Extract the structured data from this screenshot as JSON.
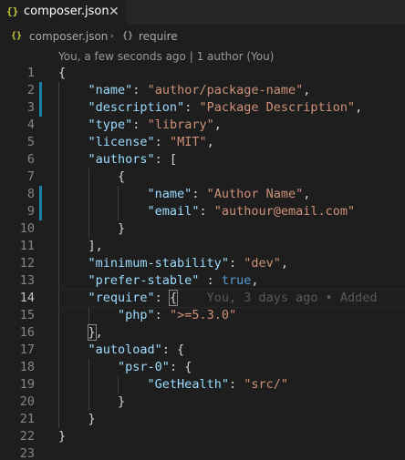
{
  "tab": {
    "icon_glyph": "{}",
    "icon_name": "json-file-icon",
    "label": "composer.json",
    "close_glyph": "✕"
  },
  "breadcrumb": {
    "file_icon_glyph": "{}",
    "file": "composer.json",
    "separator": "›",
    "symbol_icon_glyph": "{}",
    "symbol": "require"
  },
  "codelens": {
    "text": "You, a few seconds ago | 1 author (You)"
  },
  "editor": {
    "active_line": 14,
    "modified_lines": [
      2,
      3,
      8,
      9
    ],
    "colors": {
      "key": "#9cdcfe",
      "string": "#ce9178",
      "boolean": "#569cd6",
      "punctuation": "#d4d4d4",
      "gutter_modified": "#1b81a8"
    },
    "lines": [
      {
        "n": "1",
        "tokens": [
          [
            "p",
            "{"
          ]
        ]
      },
      {
        "n": "2",
        "tokens": [
          [
            "p",
            "    "
          ],
          [
            "k",
            "\"name\""
          ],
          [
            "p",
            ": "
          ],
          [
            "s",
            "\"author/package-name\""
          ],
          [
            "p",
            ","
          ]
        ]
      },
      {
        "n": "3",
        "tokens": [
          [
            "p",
            "    "
          ],
          [
            "k",
            "\"description\""
          ],
          [
            "p",
            ": "
          ],
          [
            "s",
            "\"Package Description\""
          ],
          [
            "p",
            ","
          ]
        ]
      },
      {
        "n": "4",
        "tokens": [
          [
            "p",
            "    "
          ],
          [
            "k",
            "\"type\""
          ],
          [
            "p",
            ": "
          ],
          [
            "s",
            "\"library\""
          ],
          [
            "p",
            ","
          ]
        ]
      },
      {
        "n": "5",
        "tokens": [
          [
            "p",
            "    "
          ],
          [
            "k",
            "\"license\""
          ],
          [
            "p",
            ": "
          ],
          [
            "s",
            "\"MIT\""
          ],
          [
            "p",
            ","
          ]
        ]
      },
      {
        "n": "6",
        "tokens": [
          [
            "p",
            "    "
          ],
          [
            "k",
            "\"authors\""
          ],
          [
            "p",
            ": ["
          ]
        ]
      },
      {
        "n": "7",
        "tokens": [
          [
            "p",
            "        {"
          ]
        ]
      },
      {
        "n": "8",
        "tokens": [
          [
            "p",
            "            "
          ],
          [
            "k",
            "\"name\""
          ],
          [
            "p",
            ": "
          ],
          [
            "s",
            "\"Author Name\""
          ],
          [
            "p",
            ","
          ]
        ]
      },
      {
        "n": "9",
        "tokens": [
          [
            "p",
            "            "
          ],
          [
            "k",
            "\"email\""
          ],
          [
            "p",
            ": "
          ],
          [
            "s",
            "\"authour@email.com\""
          ]
        ]
      },
      {
        "n": "10",
        "tokens": [
          [
            "p",
            "        }"
          ]
        ]
      },
      {
        "n": "11",
        "tokens": [
          [
            "p",
            "    ],"
          ]
        ]
      },
      {
        "n": "12",
        "tokens": [
          [
            "p",
            "    "
          ],
          [
            "k",
            "\"minimum-stability\""
          ],
          [
            "p",
            ": "
          ],
          [
            "s",
            "\"dev\""
          ],
          [
            "p",
            ","
          ]
        ]
      },
      {
        "n": "13",
        "tokens": [
          [
            "p",
            "    "
          ],
          [
            "k",
            "\"prefer-stable\""
          ],
          [
            "p",
            " : "
          ],
          [
            "b",
            "true"
          ],
          [
            "p",
            ","
          ]
        ]
      },
      {
        "n": "14",
        "tokens": [
          [
            "p",
            "    "
          ],
          [
            "k",
            "\"require\""
          ],
          [
            "p",
            ": "
          ],
          [
            "hl",
            "{"
          ],
          [
            "blame",
            "    You, 3 days ago • Added"
          ]
        ]
      },
      {
        "n": "15",
        "tokens": [
          [
            "p",
            "        "
          ],
          [
            "k",
            "\"php\""
          ],
          [
            "p",
            ": "
          ],
          [
            "s",
            "\">=5.3.0\""
          ]
        ]
      },
      {
        "n": "16",
        "tokens": [
          [
            "p",
            "    "
          ],
          [
            "hl",
            "}"
          ],
          [
            "p",
            ","
          ]
        ]
      },
      {
        "n": "17",
        "tokens": [
          [
            "p",
            "    "
          ],
          [
            "k",
            "\"autoload\""
          ],
          [
            "p",
            ": {"
          ]
        ]
      },
      {
        "n": "18",
        "tokens": [
          [
            "p",
            "        "
          ],
          [
            "k",
            "\"psr-0\""
          ],
          [
            "p",
            ": {"
          ]
        ]
      },
      {
        "n": "19",
        "tokens": [
          [
            "p",
            "            "
          ],
          [
            "k",
            "\"GetHealth\""
          ],
          [
            "p",
            ": "
          ],
          [
            "s",
            "\"src/\""
          ]
        ]
      },
      {
        "n": "20",
        "tokens": [
          [
            "p",
            "        }"
          ]
        ]
      },
      {
        "n": "21",
        "tokens": [
          [
            "p",
            "    }"
          ]
        ]
      },
      {
        "n": "22",
        "tokens": [
          [
            "p",
            "}"
          ]
        ]
      },
      {
        "n": "23",
        "tokens": []
      }
    ]
  }
}
